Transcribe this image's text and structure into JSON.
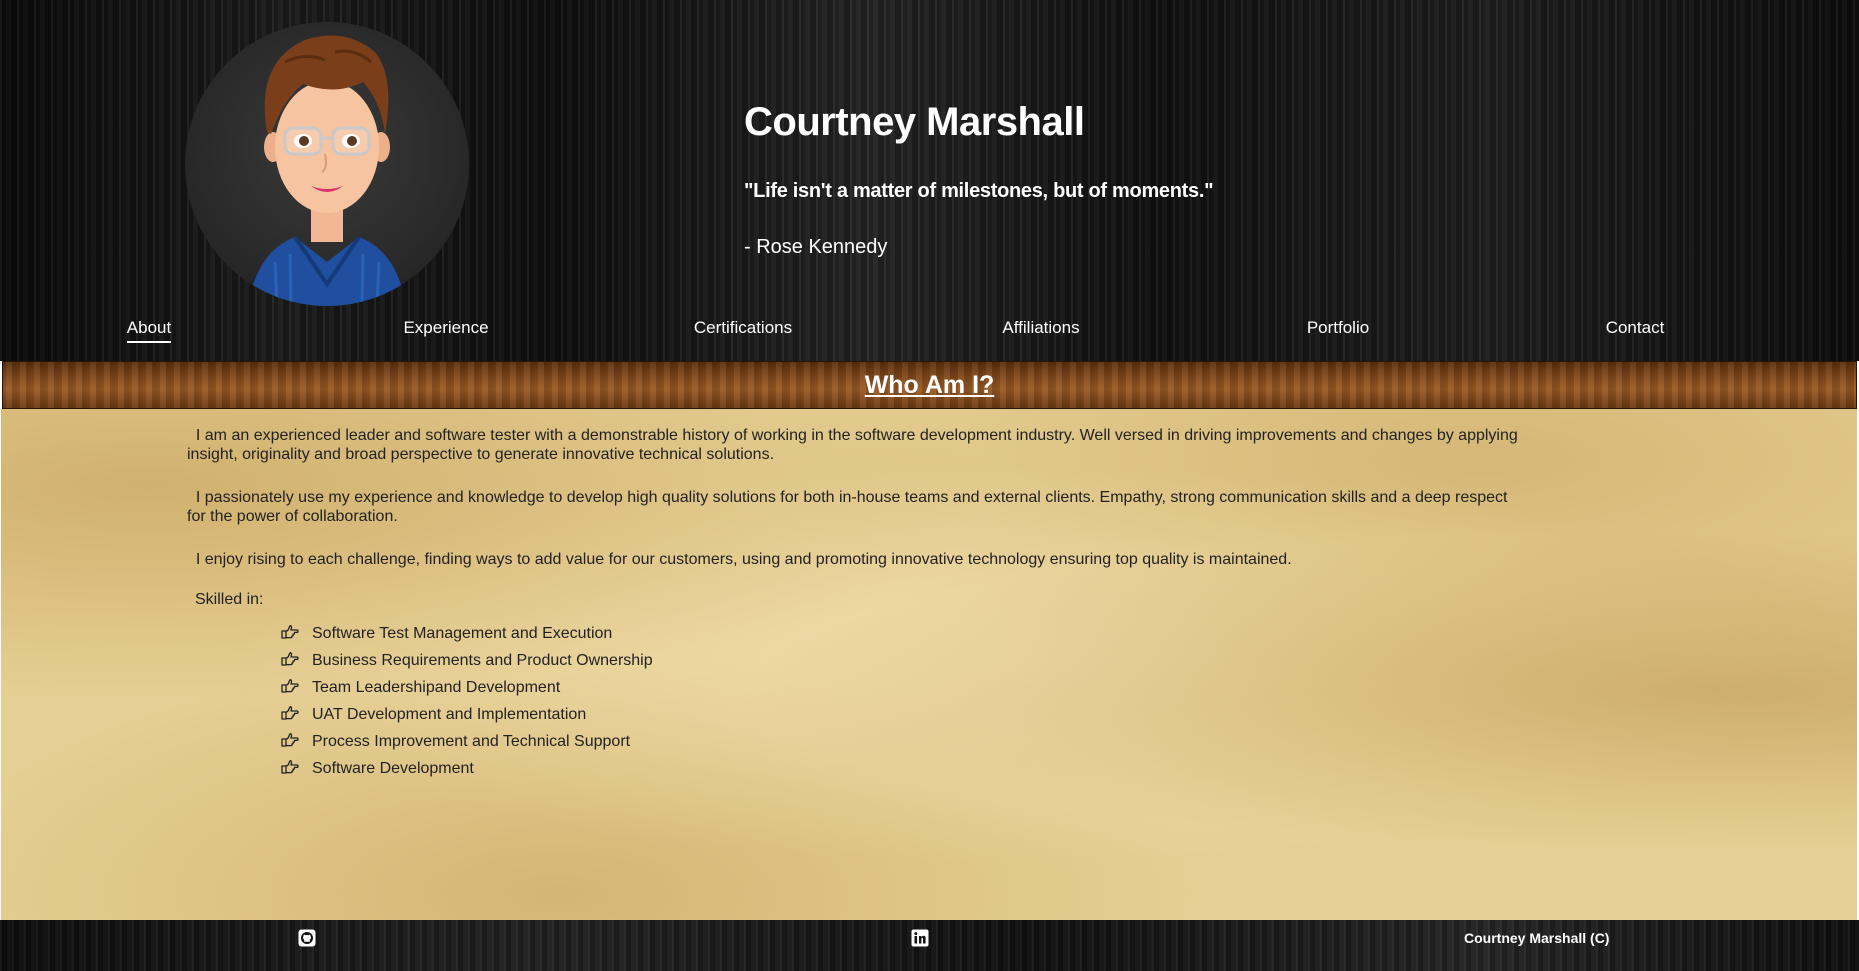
{
  "header": {
    "name": "Courtney Marshall",
    "quote": "\"Life isn't a matter of milestones, but of moments.\"",
    "author": "- Rose Kennedy",
    "avatar_icon": "cartoon-avatar"
  },
  "nav": {
    "items": [
      {
        "label": "About",
        "active": true
      },
      {
        "label": "Experience",
        "active": false
      },
      {
        "label": "Certifications",
        "active": false
      },
      {
        "label": "Affiliations",
        "active": false
      },
      {
        "label": "Portfolio",
        "active": false
      },
      {
        "label": "Contact",
        "active": false
      }
    ]
  },
  "section": {
    "title": "Who Am I?"
  },
  "about": {
    "paragraphs": [
      "I am an experienced leader and software tester with a demonstrable history of working in the software development industry. Well versed in driving improvements and changes by applying insight, originality and broad perspective to generate innovative technical solutions.",
      "I passionately use my experience and knowledge to develop high quality solutions for both in-house teams and external clients. Empathy, strong communication skills and a deep respect for the power of collaboration.",
      "I enjoy rising to each challenge, finding ways to add value for our customers, using and promoting innovative technology ensuring top quality is maintained."
    ],
    "skills_label": "Skilled in:",
    "skills_icon": "hand-point-right-icon",
    "skills": [
      "Software Test Management and Execution",
      "Business Requirements and Product Ownership",
      "Team Leadershipand Development",
      "UAT Development and Implementation",
      "Process Improvement and Technical Support",
      "Software Development"
    ]
  },
  "footer": {
    "github_icon": "github-icon",
    "linkedin_icon": "linkedin-icon",
    "copyright": "Courtney Marshall (C)"
  },
  "colors": {
    "header_bg": "#141414",
    "section_bar": "#7a4316",
    "parchment": "#e6cf94",
    "text": "#222222",
    "header_text": "#ffffff"
  }
}
